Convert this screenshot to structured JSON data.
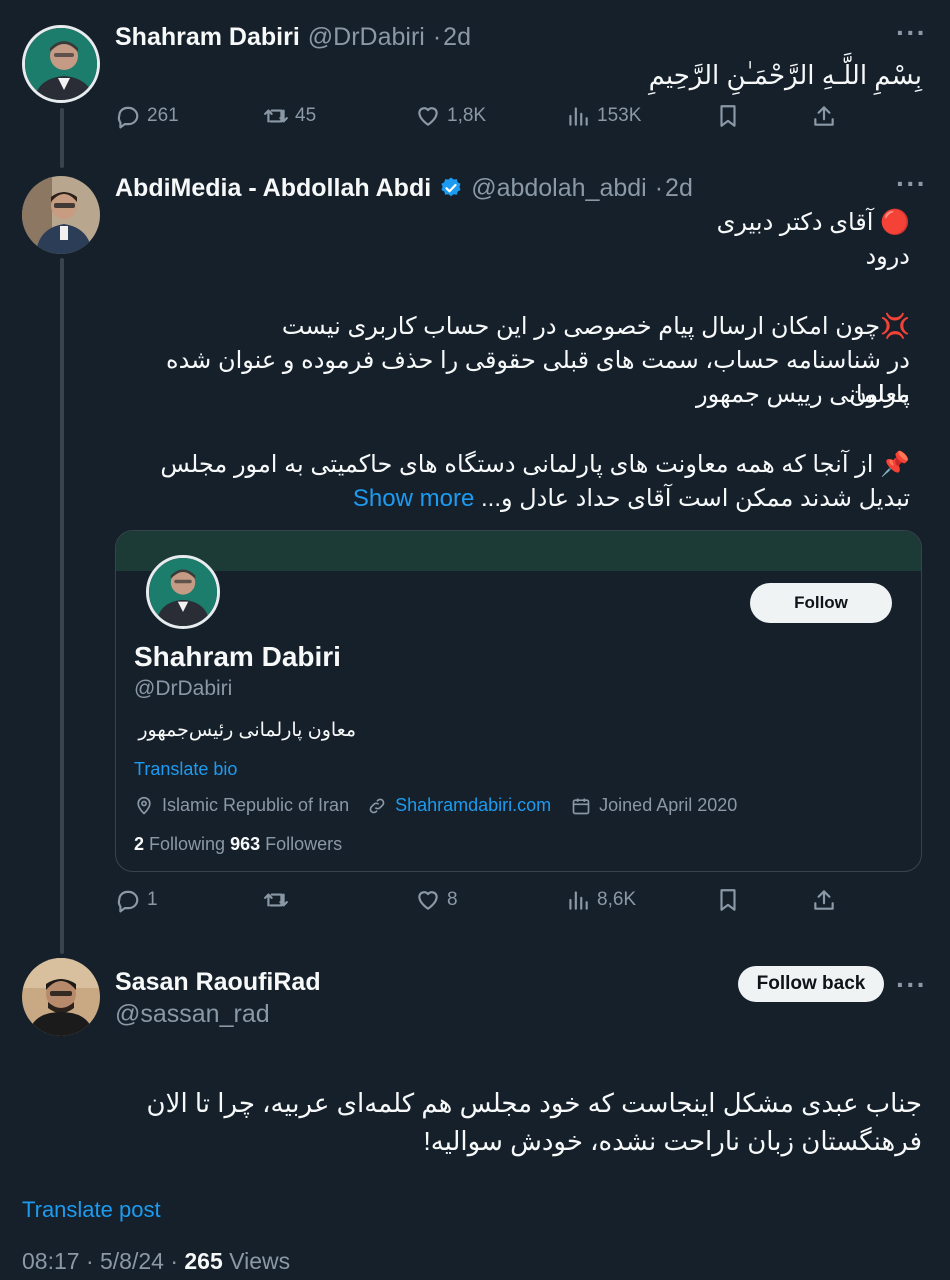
{
  "tweet1": {
    "name": "Shahram Dabiri",
    "handle": "@DrDabiri",
    "time": "2d",
    "text": "بِسْمِ اللَّـهِ الرَّحْمَـٰنِ الرَّحِيمِ",
    "replies": "261",
    "retweets": "45",
    "likes": "1,8K",
    "views": "153K"
  },
  "tweet2": {
    "name": "AbdiMedia - Abdollah Abdi",
    "handle": "@abdolah_abdi",
    "time": "2d",
    "line1_icon": "🔴",
    "line1": "آقای دکتر دبیری",
    "line2": "درود",
    "line3_icon": "💢",
    "line3": "چون امکان ارسال پیام خصوصی در این حساب کاربری نیست",
    "line4": "در شناسنامه حساب، سمت های قبلی حقوقی را حذف فرموده و عنوان شده معاون",
    "line5": "پارلمانی رییس جمهور",
    "line6_icon": "📌",
    "line6": "از آنجا که همه معاونت های پارلمانی دستگاه های حاکمیتی به امور مجلس",
    "line7": "تبدیل شدند ممکن است آقای حداد عادل و...",
    "show_more": "Show more",
    "replies": "1",
    "retweets": "",
    "likes": "8",
    "views": "8,6K"
  },
  "card": {
    "follow_label": "Follow",
    "name": "Shahram Dabiri",
    "handle": "@DrDabiri",
    "bio": "معاون پارلمانی رئیس‌جمهور",
    "translate_bio": "Translate bio",
    "location": "Islamic Republic of Iran",
    "website": "Shahramdabiri.com",
    "joined": "Joined April 2020",
    "following_count": "2",
    "following_label": "Following",
    "followers_count": "963",
    "followers_label": "Followers"
  },
  "tweet3": {
    "name": "Sasan RaoufiRad",
    "handle": "@sassan_rad",
    "follow_back_label": "Follow back",
    "line1": "جناب عبدی مشکل اینجاست که خود مجلس هم کلمه‌ای عربیه، چرا تا الان",
    "line2": "فرهنگستان زبان ناراحت نشده، خودش سوالیه!",
    "translate_post": "Translate post",
    "timestamp": "08:17 · 5/8/24 ·",
    "views_count": "265",
    "views_label": "Views"
  },
  "colors": {
    "background": "#15202b",
    "text": "#f7f9f9",
    "muted": "#8b98a5",
    "accent": "#1d9bf0",
    "border": "#38444d"
  },
  "icons": [
    "reply-icon",
    "retweet-icon",
    "like-icon",
    "views-icon",
    "bookmark-icon",
    "share-icon",
    "verified-badge-icon",
    "location-icon",
    "link-icon",
    "calendar-icon",
    "more-icon"
  ]
}
